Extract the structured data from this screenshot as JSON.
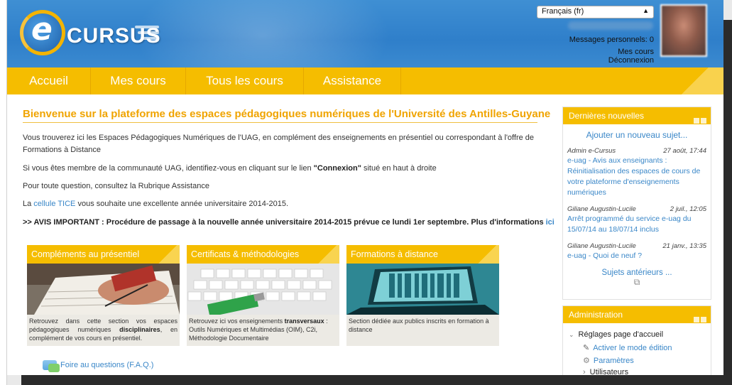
{
  "header": {
    "logo_letter": "e",
    "logo_text": "CURSUS",
    "language": "Français (fr)",
    "messages": "Messages personnels: 0",
    "my_courses": "Mes cours",
    "logout": "Déconnexion"
  },
  "nav": {
    "items": [
      "Accueil",
      "Mes cours",
      "Tous les cours",
      "Assistance"
    ]
  },
  "main": {
    "title": "Bienvenue sur la plateforme des espaces pédagogiques numériques de l'Université des Antilles-Guyane",
    "p1": "Vous trouverez ici les Espaces Pédagogiques Numériques de l'UAG, en complément des enseignements en présentiel ou correspondant à l'offre de Formations à Distance",
    "p2_before": "Si vous êtes membre de la communauté UAG, identifiez-vous en cliquant sur le lien ",
    "p2_bold": "\"Connexion\"",
    "p2_after": " situé en haut à droite",
    "p3": "Pour toute question, consultez la Rubrique Assistance",
    "p4_before": "La ",
    "p4_link": "cellule TICE",
    "p4_after": " vous souhaite une excellente année universitaire 2014-2015.",
    "avis_text": ">> AVIS IMPORTANT : Procédure de passage à la nouvelle année universitaire 2014-2015 prévue ce lundi 1er septembre. Plus d'informations ",
    "avis_link": "ici",
    "faq": "Foire au questions (F.A.Q.)"
  },
  "cards": [
    {
      "title": "Compléments au présentiel",
      "text_before": "Retrouvez dans cette section vos espaces pédagogiques numériques ",
      "text_bold": "disciplinaires",
      "text_after": ", en complément de vos cours en présentiel."
    },
    {
      "title": "Certificats & méthodologies",
      "text_before": "Retrouvez ici vos enseignements ",
      "text_bold": "transversaux",
      "text_after": " : Outils Numériques et Multimédias (OIM), C2i, Méthodologie Documentaire"
    },
    {
      "title": "Formations à distance",
      "text_before": "Section dédiée aux publics inscrits en formation à distance",
      "text_bold": "",
      "text_after": ""
    }
  ],
  "news": {
    "title": "Dernières nouvelles",
    "add": "Ajouter un nouveau sujet...",
    "items": [
      {
        "author": "Admin e-Cursus",
        "date": "27 août, 17:44",
        "title": "e-uag - Avis aux enseignants : Réinitialisation des espaces de cours de votre plateforme d'enseignements numériques"
      },
      {
        "author": "Giliane Augustin-Lucile",
        "date": "2 juil., 12:05",
        "title": "Arrêt programmé du service e-uag du 15/07/14 au 18/07/14 inclus"
      },
      {
        "author": "Giliane Augustin-Lucile",
        "date": "21 janv., 13:35",
        "title": "e-uag - Quoi de neuf ?"
      }
    ],
    "older": "Sujets antérieurs ...",
    "rss": "rss-icon"
  },
  "admin": {
    "title": "Administration",
    "settings": "Réglages page d'accueil",
    "edit_mode": "Activer le mode édition",
    "params": "Paramètres",
    "users": "Utilisateurs"
  },
  "colors": {
    "accent": "#f5bd00",
    "header_blue": "#3181cb",
    "link": "#3a87c8",
    "title": "#f0a400"
  }
}
